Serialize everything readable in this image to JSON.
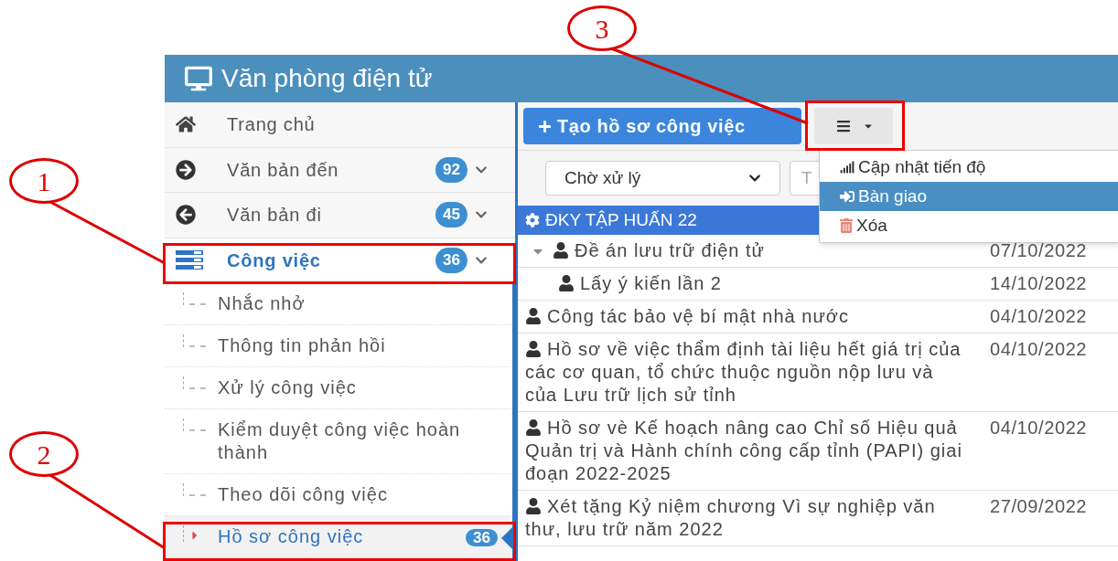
{
  "annotations": [
    {
      "label": "1"
    },
    {
      "label": "2"
    },
    {
      "label": "3"
    }
  ],
  "app": {
    "title": "Văn phòng điện tử"
  },
  "sidebar": {
    "items": [
      {
        "label": "Trang chủ",
        "selected": false
      },
      {
        "label": "Văn bản đến",
        "badge": "92",
        "selected": false
      },
      {
        "label": "Văn bản đi",
        "badge": "45",
        "selected": false
      },
      {
        "label": "Công việc",
        "badge": "36",
        "selected": true,
        "children": [
          {
            "label": "Nhắc nhở",
            "selected": false
          },
          {
            "label": "Thông tin phản hồi",
            "selected": false
          },
          {
            "label": "Xử lý công việc",
            "selected": false
          },
          {
            "label": "Kiểm duyệt công việc hoàn thành",
            "selected": false
          },
          {
            "label": "Theo dõi công việc",
            "selected": false
          },
          {
            "label": "Hồ sơ công việc",
            "badge": "36",
            "selected": true
          }
        ]
      }
    ]
  },
  "toolbar": {
    "create_button": "Tạo hồ sơ công việc"
  },
  "filter": {
    "status": "Chờ xử lý",
    "search_placeholder": "T"
  },
  "menu": {
    "items": [
      {
        "label": "Cập nhật tiến độ",
        "selected": false
      },
      {
        "label": "Bàn giao",
        "selected": true
      },
      {
        "label": "Xóa",
        "selected": false
      }
    ]
  },
  "group": {
    "title": "ĐKY TẬP HUẤN 22"
  },
  "rows": [
    {
      "title": "Đề án lưu trữ điện tử",
      "date": "07/10/2022",
      "expanded": true,
      "children": [
        {
          "title": "Lấy ý kiến lần 2",
          "date": "14/10/2022"
        }
      ]
    },
    {
      "title": "Công tác bảo vệ bí mật nhà nước",
      "date": "04/10/2022"
    },
    {
      "title": "Hồ sơ về việc thẩm định tài liệu hết giá trị của các cơ quan, tổ chức thuộc nguồn nộp lưu và của Lưu trữ lịch sử tỉnh",
      "date": "04/10/2022"
    },
    {
      "title": "Hồ sơ vè Kế hoạch nâng cao Chỉ số Hiệu quả Quản trị và Hành chính công cấp tỉnh (PAPI) giai đoạn 2022-2025",
      "date": "04/10/2022"
    },
    {
      "title": "Xét tặng Kỷ niệm chương Vì sự nghiệp văn thư, lưu trữ năm 2022",
      "date": "27/09/2022"
    }
  ]
}
